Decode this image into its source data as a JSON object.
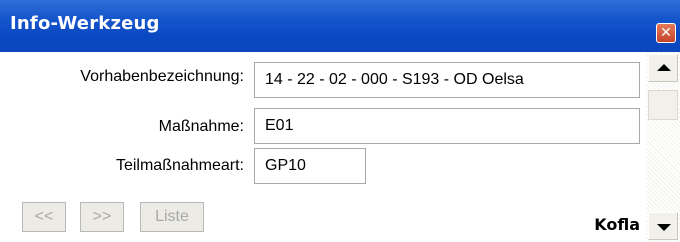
{
  "window": {
    "title": "Info-Werkzeug",
    "close_symbol": "✕"
  },
  "fields": [
    {
      "label": "Vorhabenbezeichnung:",
      "value": "14 - 22 - 02 - 000 - S193 - OD Oelsa"
    },
    {
      "label": "Maßnahme:",
      "value": "E01"
    },
    {
      "label": "Teilmaßnahmeart:",
      "value": "GP10"
    }
  ],
  "footer": {
    "prev_label": "<<",
    "next_label": ">>",
    "list_label": "Liste",
    "brand": "Kofla"
  },
  "colors": {
    "titlebar": "#0a48c2",
    "close_button": "#d9573a",
    "disabled_text": "#a8a8a8"
  },
  "icons": {
    "close": "close-icon",
    "scroll_up": "scroll-up-arrow-icon",
    "scroll_down": "scroll-down-arrow-icon"
  }
}
